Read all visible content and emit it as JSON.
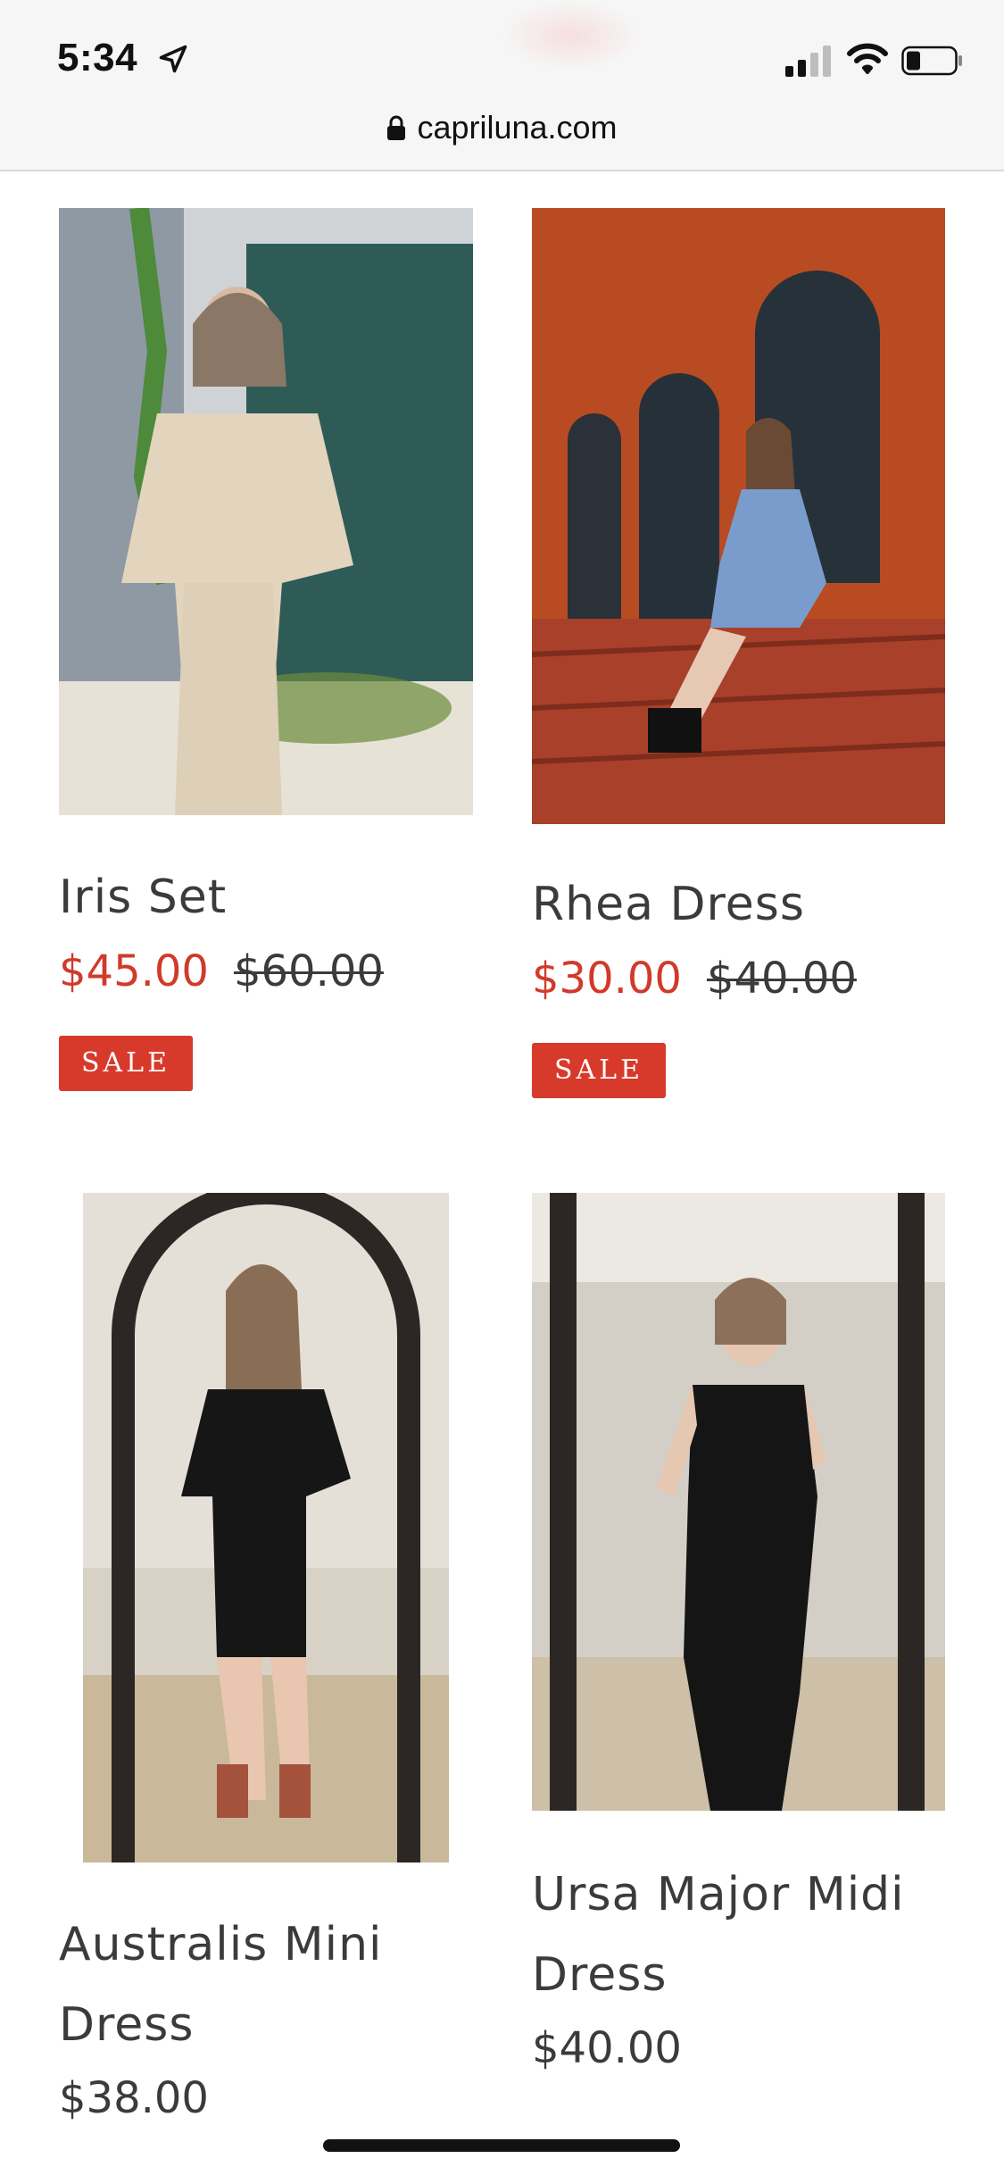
{
  "status_bar": {
    "time": "5:34"
  },
  "browser": {
    "url": "capriluna.com"
  },
  "products": [
    {
      "name": "Iris Set",
      "sale_price": "$45.00",
      "original_price": "$60.00",
      "badge": "SALE"
    },
    {
      "name": "Rhea Dress",
      "sale_price": "$30.00",
      "original_price": "$40.00",
      "badge": "SALE"
    },
    {
      "name_line1": "Australis Mini",
      "name_line2": "Dress",
      "price": "$38.00"
    },
    {
      "name_line1": "Ursa Major Midi",
      "name_line2": "Dress",
      "price": "$40.00"
    }
  ],
  "colors": {
    "sale": "#d13a2a",
    "badge": "#d7392b",
    "text": "#3b3b3b"
  }
}
